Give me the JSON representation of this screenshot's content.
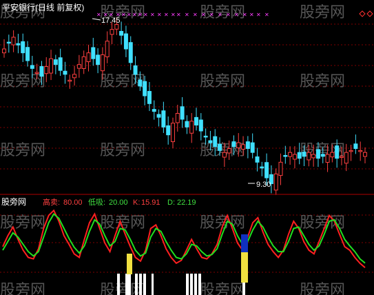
{
  "window": {
    "title": "平安银行(日线 前复权)"
  },
  "watermark": "股旁网",
  "colors": {
    "up": "#ff4040",
    "down": "#40e0ff",
    "grid": "#800000",
    "marker": "#ff40ff",
    "k_line": "#ff2020",
    "d_line": "#20e020",
    "bar_white": "#ffffff",
    "bar_blue": "#1030c0",
    "bar_yellow": "#f0e040"
  },
  "price_panel": {
    "annotations": {
      "high": "17.45",
      "low": "9.30"
    },
    "icons": [
      "diamond-icon",
      "diamond-icon"
    ]
  },
  "indicator_panel": {
    "name": "股旁网",
    "params": [
      {
        "label": "高卖:",
        "value": "80.00"
      },
      {
        "label": "低吸:",
        "value": "20.00"
      },
      {
        "label": "K:",
        "value": "15.91"
      },
      {
        "label": "D:",
        "value": "22.19"
      }
    ]
  },
  "chart_data": {
    "type": "line",
    "candles_close": [
      16.2,
      16.5,
      16.8,
      16.4,
      16.0,
      15.6,
      15.2,
      15.0,
      14.8,
      15.3,
      15.7,
      15.4,
      15.1,
      14.9,
      14.6,
      14.9,
      15.4,
      15.8,
      16.0,
      15.7,
      15.4,
      15.9,
      16.6,
      17.2,
      17.45,
      16.9,
      16.2,
      15.5,
      14.9,
      14.3,
      13.8,
      13.4,
      13.0,
      12.7,
      12.2,
      11.8,
      12.4,
      12.9,
      12.6,
      12.2,
      12.5,
      12.3,
      12.0,
      11.7,
      11.4,
      11.2,
      11.0,
      10.9,
      11.1,
      11.2,
      11.4,
      11.3,
      11.1,
      10.9,
      10.4,
      10.1,
      9.6,
      9.3,
      9.8,
      10.4,
      10.7,
      10.9,
      10.8,
      10.6,
      10.7,
      10.9,
      10.8,
      10.6,
      10.7,
      10.8,
      10.9,
      10.6,
      10.7,
      10.9,
      11.0,
      11.1,
      11.0,
      10.9
    ],
    "series": [
      {
        "name": "K",
        "values": [
          45,
          60,
          72,
          55,
          40,
          30,
          28,
          42,
          70,
          88,
          95,
          80,
          60,
          48,
          35,
          30,
          55,
          78,
          90,
          70,
          50,
          38,
          60,
          80,
          62,
          45,
          30,
          25,
          40,
          70,
          75,
          60,
          42,
          30,
          22,
          26,
          40,
          55,
          42,
          30,
          28,
          35,
          48,
          72,
          88,
          70,
          50,
          40,
          58,
          78,
          85,
          65,
          48,
          38,
          30,
          40,
          62,
          80,
          70,
          52,
          40,
          35,
          52,
          70,
          88,
          80,
          62,
          45,
          40,
          30,
          22,
          15.91
        ]
      },
      {
        "name": "D",
        "values": [
          40,
          52,
          64,
          58,
          48,
          38,
          32,
          38,
          58,
          78,
          90,
          84,
          70,
          56,
          44,
          36,
          46,
          66,
          82,
          76,
          60,
          46,
          52,
          70,
          68,
          55,
          40,
          32,
          36,
          58,
          70,
          66,
          52,
          40,
          30,
          28,
          35,
          48,
          46,
          38,
          32,
          34,
          42,
          62,
          80,
          76,
          60,
          48,
          52,
          68,
          80,
          72,
          58,
          46,
          38,
          38,
          52,
          70,
          72,
          60,
          48,
          40,
          46,
          62,
          80,
          82,
          70,
          55,
          46,
          38,
          28,
          22.19
        ]
      }
    ],
    "ylim_price": [
      9.0,
      18.0
    ],
    "ylim_indicator": [
      0,
      100
    ]
  }
}
